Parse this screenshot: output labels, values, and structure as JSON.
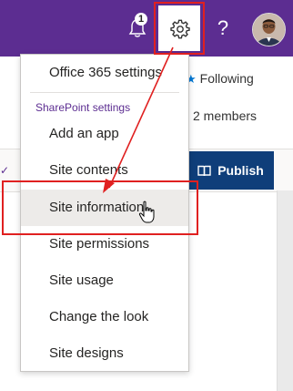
{
  "topbar": {
    "notification_count": "1",
    "help_symbol": "?",
    "icons": [
      "bell-icon",
      "gear-icon",
      "help-icon",
      "avatar"
    ],
    "brand_color": "#5c2d91"
  },
  "background": {
    "following_label": "Following",
    "members_label": "2 members",
    "publish_label": "Publish"
  },
  "settings_menu": {
    "items_top": [
      {
        "label": "Office 365 settings"
      }
    ],
    "section_label": "SharePoint settings",
    "items": [
      {
        "label": "Add an app"
      },
      {
        "label": "Site contents"
      },
      {
        "label": "Site information"
      },
      {
        "label": "Site permissions"
      },
      {
        "label": "Site usage"
      },
      {
        "label": "Change the look"
      },
      {
        "label": "Site designs"
      }
    ],
    "highlighted_item": "Site information"
  },
  "colors": {
    "annotation_red": "#e02020",
    "publish_bg": "#0f3e7a",
    "highlight_bg": "#edebe9"
  }
}
